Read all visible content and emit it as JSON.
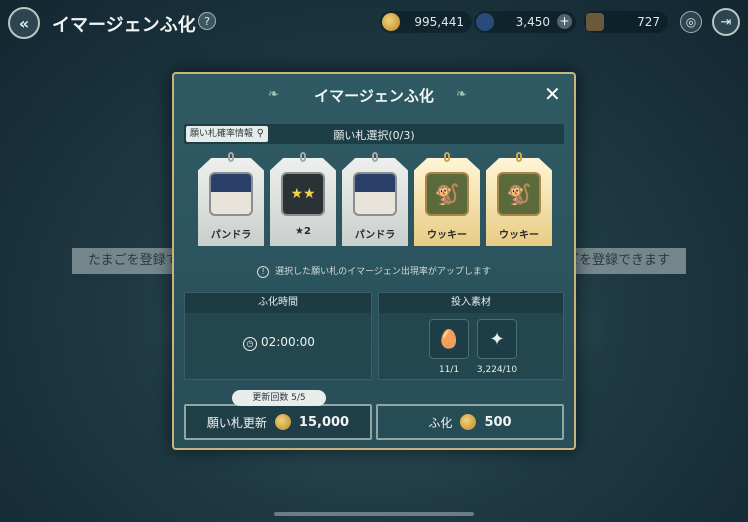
{
  "screen": {
    "title": "イマージェンふ化"
  },
  "resources": {
    "gold": "995,441",
    "gems": "3,450",
    "bag": "727"
  },
  "background": {
    "left_banner": "たまごを登録で",
    "right_banner": "ごを登録できます"
  },
  "dialog": {
    "title": "イマージェンふ化",
    "close": "✕",
    "odds_button": "願い札確率情報",
    "select_title": "願い札選択(0/3)",
    "cards": [
      {
        "label": "パンドラ",
        "rarity": "silver"
      },
      {
        "label": "★2",
        "rarity": "silver"
      },
      {
        "label": "パンドラ",
        "rarity": "silver"
      },
      {
        "label": "ウッキー",
        "rarity": "gold"
      },
      {
        "label": "ウッキー",
        "rarity": "gold"
      }
    ],
    "notice": "選択した願い札のイマージェン出現率がアップします",
    "time_header": "ふ化時間",
    "time_value": "02:00:00",
    "materials_header": "投入素材",
    "materials": [
      {
        "name": "egg-icon",
        "count": "11/1"
      },
      {
        "name": "star-material-icon",
        "count": "3,224/10"
      }
    ],
    "refresh_count": "更新回数 5/5",
    "refresh_label": "願い札更新",
    "refresh_cost": "15,000",
    "hatch_label": "ふ化",
    "hatch_cost": "500"
  }
}
